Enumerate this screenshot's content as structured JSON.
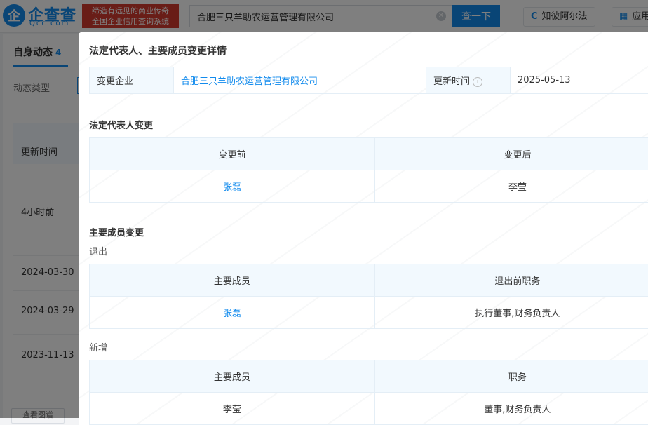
{
  "header": {
    "logo_name": "企查查",
    "logo_mark": "企",
    "logo_domain": "Qcc.com",
    "slogan_line1": "缔造有远见的商业传奇",
    "slogan_line2": "全国企业信用查询系统",
    "search_value": "合肥三只羊助农运营管理有限公司",
    "search_button": "查一下",
    "link_alpha": "知彼阿尔法",
    "link_app": "应用"
  },
  "background_page": {
    "tab_label": "自身动态",
    "tab_count": "4",
    "filter_label": "动态类型",
    "column_header": "更新时间",
    "rows": [
      "4小时前",
      "2024-03-30",
      "2024-03-29",
      "2023-11-13"
    ],
    "footer_button": "查看图谱"
  },
  "modal": {
    "title": "法定代表人、主要成员变更详情",
    "info": {
      "company_label": "变更企业",
      "company_value": "合肥三只羊助农运营管理有限公司",
      "time_label": "更新时间",
      "time_value": "2025-05-13"
    },
    "legal_rep": {
      "title": "法定代表人变更",
      "col_before": "变更前",
      "col_after": "变更后",
      "before": "张磊",
      "after": "李莹"
    },
    "members": {
      "title": "主要成员变更",
      "exit": {
        "label": "退出",
        "col_member": "主要成员",
        "col_role": "退出前职务",
        "member": "张磊",
        "role": "执行董事,财务负责人"
      },
      "added": {
        "label": "新增",
        "col_member": "主要成员",
        "col_role": "职务",
        "member": "李莹",
        "role": "董事,财务负责人"
      }
    }
  }
}
